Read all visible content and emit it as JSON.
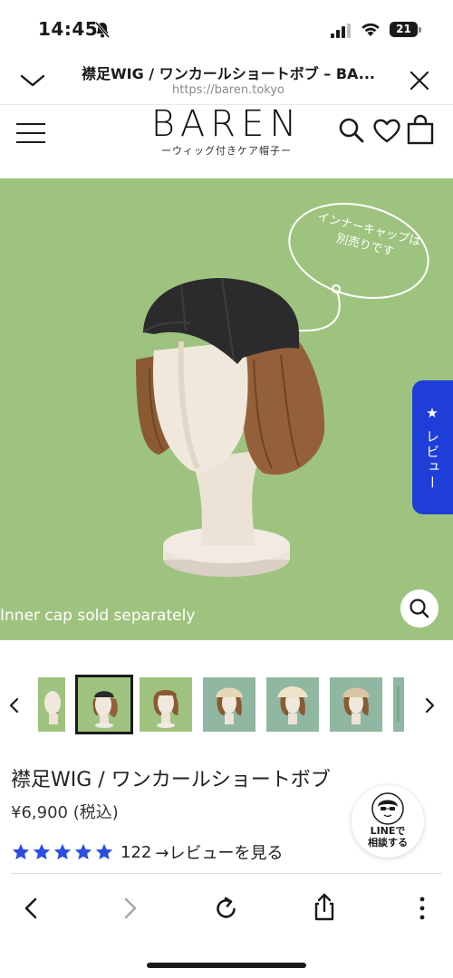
{
  "status_bar": {
    "time": "14:45",
    "battery": "21",
    "icons": [
      "bell-slash-icon",
      "signal-icon",
      "wifi-icon",
      "battery-icon"
    ]
  },
  "browser": {
    "page_title": "襟足WIG / ワンカールショートボブ – BA...",
    "url": "https://baren.tokyo"
  },
  "site": {
    "logo": "BAREN",
    "logo_sub": "ーウィッグ付きケア帽子ー"
  },
  "hero": {
    "bubble_line1": "インナーキャップは",
    "bubble_line2": "別売りです",
    "caption": "Inner cap sold separately",
    "review_tab": "★ レビュー",
    "background": "#9ec37f"
  },
  "thumbnails": {
    "count": 8,
    "active_index": 1
  },
  "product": {
    "title": "襟足WIG / ワンカールショートボブ",
    "price": "¥6,900 (税込)",
    "rating_stars": 5,
    "review_count": "122",
    "review_link": "→レビューを見る",
    "star_color": "#2d4de0"
  },
  "line_button": {
    "line1": "LINEで",
    "line2": "相談する"
  },
  "bottom_bar": {
    "icons": [
      "back-icon",
      "forward-icon",
      "reload-icon",
      "share-icon",
      "more-icon"
    ]
  }
}
